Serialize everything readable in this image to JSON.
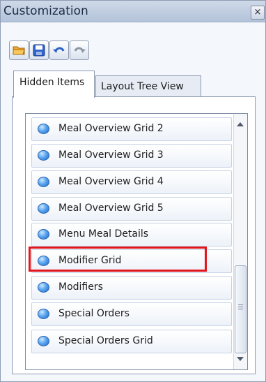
{
  "window": {
    "title": "Customization",
    "close_glyph": "×"
  },
  "toolbar": {
    "buttons": [
      {
        "name": "open-folder-icon"
      },
      {
        "name": "save-disk-icon"
      },
      {
        "name": "undo-arrow-icon"
      },
      {
        "name": "redo-arrow-icon"
      }
    ]
  },
  "tabs": [
    {
      "label": "Hidden Items",
      "active": true
    },
    {
      "label": "Layout Tree View",
      "active": false
    }
  ],
  "list": {
    "items": [
      {
        "label": "Meal Overview Grid 2"
      },
      {
        "label": "Meal Overview Grid 3"
      },
      {
        "label": "Meal Overview Grid 4"
      },
      {
        "label": "Meal Overview Grid 5"
      },
      {
        "label": "Menu Meal Details"
      },
      {
        "label": "Modifier Grid",
        "highlighted": true
      },
      {
        "label": "Modifiers"
      },
      {
        "label": "Special Orders"
      },
      {
        "label": "Special Orders Grid"
      }
    ]
  },
  "colors": {
    "highlight": "#e3141b",
    "bullet": "#3a8ee6"
  }
}
